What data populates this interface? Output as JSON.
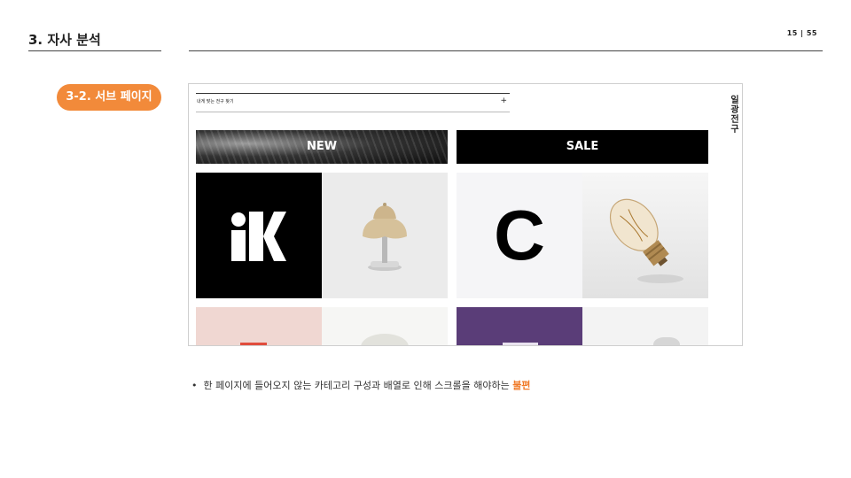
{
  "header": {
    "section_title": "3. 자사 분석",
    "page_current": "15",
    "page_sep": "|",
    "page_total": "55"
  },
  "sub_badge": "3-2. 서브 페이지",
  "screenshot": {
    "search_text": "내게 맞는 전구 찾기",
    "search_plus": "+",
    "brand_vertical": "일광전구",
    "banners": {
      "new_label": "NEW",
      "sale_label": "SALE"
    },
    "logo_c": "C",
    "colors": {
      "pink": "#f0d7d2",
      "purple": "#5a3d78",
      "black": "#000000"
    }
  },
  "bullet": {
    "marker": "•",
    "text": "한 페이지에 들어오지 않는 카테고리 구성과 배열로 인해 스크롤을 해야하는",
    "highlight": "불편"
  },
  "accent_color": "#f28a3a"
}
